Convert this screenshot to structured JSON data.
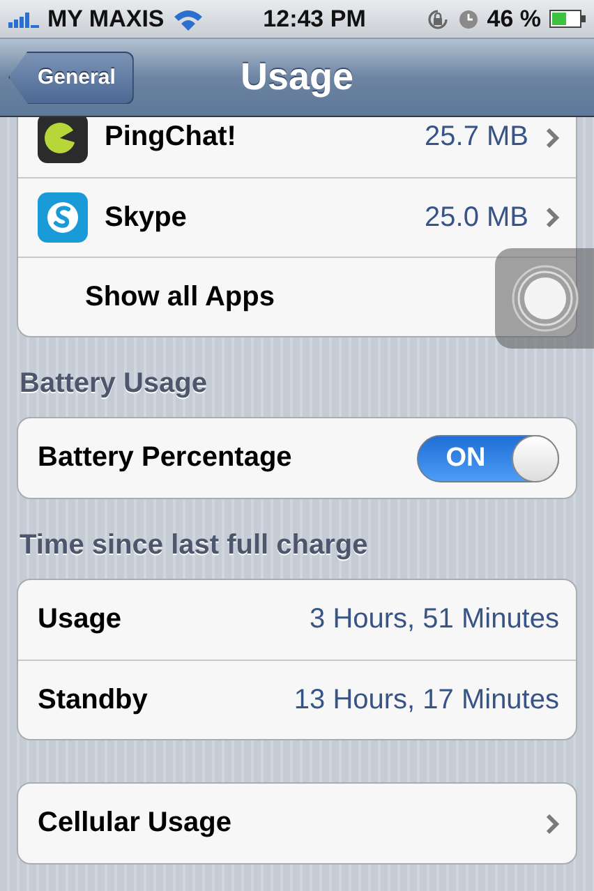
{
  "status_bar": {
    "carrier": "MY MAXIS",
    "time": "12:43 PM",
    "battery": "46 %"
  },
  "nav_bar": {
    "back": "General",
    "title": "Usage"
  },
  "app_list": [
    {
      "kind": "app",
      "name": "PingChat!",
      "size": "25.7 MB"
    },
    {
      "kind": "app",
      "name": "Skype",
      "size": "25.0 MB"
    },
    {
      "kind": "action",
      "name": "Show all Apps"
    }
  ],
  "battery_section": {
    "header": "Battery Usage",
    "rows": [
      {
        "label": "Battery Percentage",
        "on": true,
        "switch_text": "ON"
      }
    ]
  },
  "charge_section": {
    "header": "Time since last full charge",
    "rows": [
      {
        "label": "Usage",
        "value": "3 Hours, 51 Minutes"
      },
      {
        "label": "Standby",
        "value": "13 Hours, 17 Minutes"
      }
    ]
  },
  "cellular": {
    "label": "Cellular Usage"
  }
}
